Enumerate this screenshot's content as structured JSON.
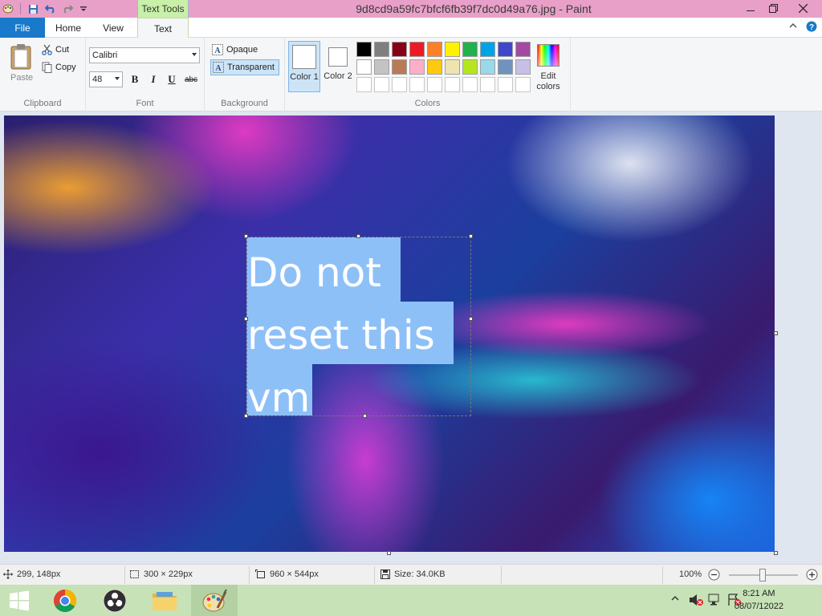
{
  "window": {
    "title": "9d8cd9a59fc7bfcf6fb39f7dc0d49a76.jpg - Paint",
    "context_tab": "Text Tools"
  },
  "tabs": {
    "file": "File",
    "home": "Home",
    "view": "View",
    "text": "Text"
  },
  "ribbon": {
    "clipboard": {
      "label": "Clipboard",
      "paste": "Paste",
      "cut": "Cut",
      "copy": "Copy"
    },
    "font": {
      "label": "Font",
      "family": "Calibri",
      "size": "48",
      "bold": "B",
      "italic": "I",
      "underline": "U",
      "strike": "abc"
    },
    "background": {
      "label": "Background",
      "opaque": "Opaque",
      "transparent": "Transparent",
      "selected": "Transparent"
    },
    "colors": {
      "label": "Colors",
      "color1": "Color 1",
      "color2": "Color 2",
      "color1_value": "#ffffff",
      "color2_value": "#ffffff",
      "edit": "Edit colors",
      "palette_row1": [
        "#000000",
        "#7f7f7f",
        "#880015",
        "#ed1c24",
        "#ff7f27",
        "#fff200",
        "#22b14c",
        "#00a2e8",
        "#3f48cc",
        "#a349a4"
      ],
      "palette_row2": [
        "#ffffff",
        "#c3c3c3",
        "#b97a57",
        "#ffaec9",
        "#ffc90e",
        "#efe4b0",
        "#b5e61d",
        "#99d9ea",
        "#7092be",
        "#c8bfe7"
      ]
    }
  },
  "canvas": {
    "text_lines": [
      "Do not",
      "reset this",
      "vm"
    ]
  },
  "status": {
    "cursor": "299, 148px",
    "selection": "300 × 229px",
    "image_size": "960 × 544px",
    "file_size": "Size: 34.0KB",
    "zoom": "100%"
  },
  "taskbar": {
    "time": "8:21 AM",
    "date": "08/07/12022"
  }
}
